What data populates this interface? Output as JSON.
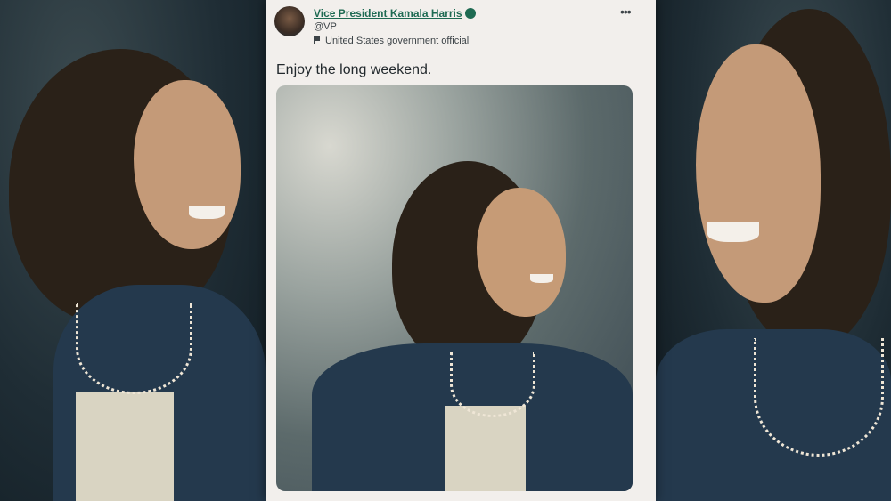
{
  "tweet": {
    "author_name": "Vice President Kamala Harris",
    "handle": "@VP",
    "account_label": "United States government official",
    "text": "Enjoy the long weekend.",
    "more_glyph": "•••"
  },
  "icons": {
    "verified": "verified-badge-icon",
    "label_flag": "flag-icon",
    "more": "more-options-icon"
  },
  "colors": {
    "name_color": "#1e6a52",
    "card_background": "#f2efec",
    "backdrop": "#1b2a33"
  }
}
